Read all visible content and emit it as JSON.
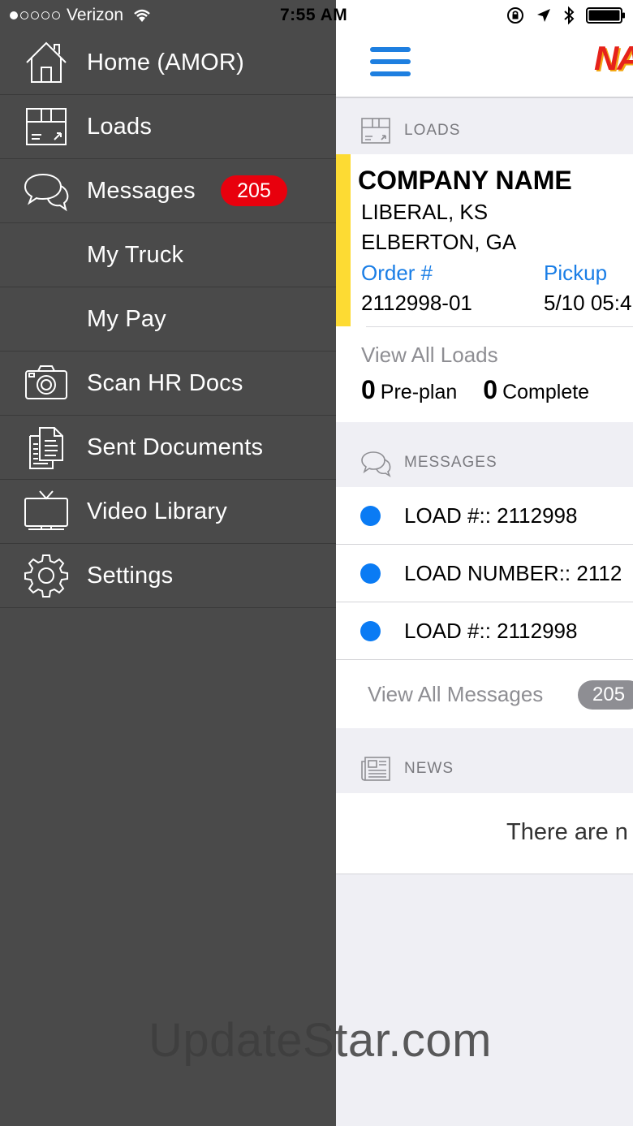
{
  "status_bar": {
    "carrier": "Verizon",
    "time": "7:55 AM"
  },
  "sidebar": {
    "items": [
      {
        "label": "Home (AMOR)",
        "icon": "home-icon"
      },
      {
        "label": "Loads",
        "icon": "box-icon"
      },
      {
        "label": "Messages",
        "icon": "chat-bubbles-icon",
        "badge": "205"
      },
      {
        "label": "My Truck",
        "icon": ""
      },
      {
        "label": "My Pay",
        "icon": ""
      },
      {
        "label": "Scan HR Docs",
        "icon": "camera-icon"
      },
      {
        "label": "Sent Documents",
        "icon": "documents-icon"
      },
      {
        "label": "Video Library",
        "icon": "tv-icon"
      },
      {
        "label": "Settings",
        "icon": "gear-icon"
      }
    ]
  },
  "header": {
    "brand": "NA"
  },
  "loads_section": {
    "title": "LOADS",
    "company": "COMPANY NAME",
    "origin": "LIBERAL, KS",
    "destination": "ELBERTON, GA",
    "order_label": "Order #",
    "order_value": "2112998-01",
    "pickup_label": "Pickup",
    "pickup_value": "5/10 05:4",
    "view_all": "View All Loads",
    "preplan_count": "0",
    "preplan_label": "Pre-plan",
    "complete_count": "0",
    "complete_label": "Complete"
  },
  "messages_section": {
    "title": "MESSAGES",
    "items": [
      {
        "text": "LOAD #:: 2112998"
      },
      {
        "text": "LOAD NUMBER:: 2112"
      },
      {
        "text": "LOAD #:: 2112998"
      }
    ],
    "view_all": "View All Messages",
    "count": "205"
  },
  "news_section": {
    "title": "NEWS",
    "empty_text": "There are n"
  },
  "watermark": "UpdateStar.com",
  "colors": {
    "sidebar_bg": "#4a4a4a",
    "accent_blue": "#1a7ee6",
    "badge_red": "#e8000d",
    "load_strip": "#fddb33"
  }
}
